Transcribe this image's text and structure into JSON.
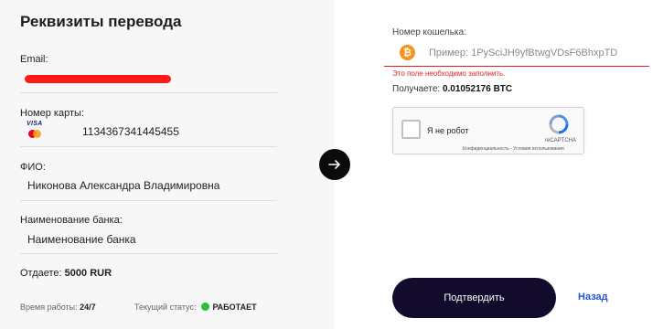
{
  "left": {
    "title": "Реквизиты перевода",
    "email": {
      "label": "Email:"
    },
    "card": {
      "label": "Номер карты:",
      "value": "1134367341445455",
      "visa_text": "VISA"
    },
    "fio": {
      "label": "ФИО:",
      "value": "Никонова Александра Владимировна"
    },
    "bank": {
      "label": "Наименование банка:",
      "value": "Наименование банка"
    },
    "amount": {
      "label": "Отдаете:",
      "value": "5000 RUR"
    },
    "hours": {
      "label": "Время работы:",
      "value": "24/7"
    },
    "status": {
      "label": "Текущий статус:",
      "value": "РАБОТАЕТ",
      "color": "#27c03a"
    }
  },
  "arrow_icon": "arrow-right-icon",
  "right": {
    "wallet": {
      "label": "Номер кошелька:",
      "placeholder": "Пример: 1PySciJH9yfBtwgVDsF6BhxpTD",
      "value": "",
      "error": "Это поле необходимо заполнить.",
      "icon": "bitcoin-icon",
      "icon_glyph": "₿",
      "icon_color": "#f7931a"
    },
    "receive": {
      "label": "Получаете:",
      "value": "0.01052176 BTC"
    },
    "captcha": {
      "label": "Я не робот",
      "brand": "reCAPTCHA",
      "terms": "Конфиденциальность - Условия использования"
    },
    "confirm_label": "Подтвердить",
    "back_label": "Назад"
  },
  "colors": {
    "accent_dark": "#120b2b",
    "link_blue": "#2455d6",
    "error_red": "#e02020",
    "redaction_red": "#ff1a1a",
    "status_green": "#27c03a"
  }
}
